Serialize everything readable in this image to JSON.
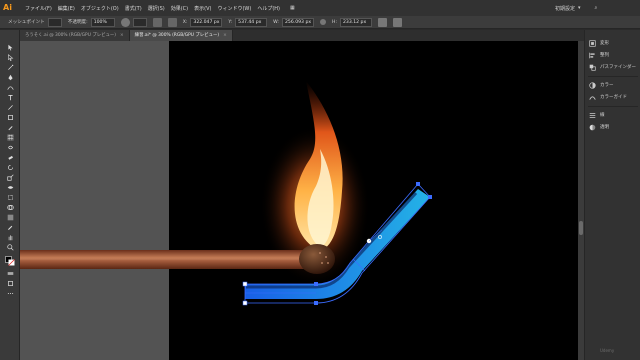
{
  "app": {
    "logo": "Ai"
  },
  "menu": {
    "items": [
      "ファイル(F)",
      "編集(E)",
      "オブジェクト(O)",
      "書式(T)",
      "選択(S)",
      "効果(C)",
      "表示(V)",
      "ウィンドウ(W)",
      "ヘルプ(H)"
    ],
    "layout_icon": "▦",
    "workspace": "初期設定",
    "layout_icon_name": "grid-icon"
  },
  "options": {
    "tool_name": "メッシュポイント",
    "opacity_label": "不透明度:",
    "opacity_value": "100%",
    "x_label": "X:",
    "x_value": "322.047 px",
    "y_label": "Y:",
    "y_value": "537.44 px",
    "w_label": "W:",
    "w_value": "256.093 px",
    "h_label": "H:",
    "h_value": "233.12 px"
  },
  "tabs": [
    {
      "label": "ろうそく.ai @ 300% (RGB/GPU プレビュー)",
      "close": "×",
      "active": false
    },
    {
      "label": "練習.ai* @ 300% (RGB/GPU プレビュー)",
      "close": "×",
      "active": true
    }
  ],
  "panels": [
    {
      "label": "変形",
      "icon": "transform-icon"
    },
    {
      "label": "整列",
      "icon": "align-icon"
    },
    {
      "label": "パスファインダー",
      "icon": "pathfinder-icon"
    },
    {
      "label": "カラー",
      "icon": "color-icon"
    },
    {
      "label": "カラーガイド",
      "icon": "color-guide-icon"
    },
    {
      "label": "線",
      "icon": "stroke-icon"
    },
    {
      "label": "透明",
      "icon": "transparency-icon"
    }
  ],
  "colors": {
    "accent": "#f89a1c",
    "flame_core": "#ffe6a8",
    "flame_outer": "#e0561a",
    "matchstick": "#a0583a",
    "selection": "#3b6cff"
  },
  "watermark": "Udemy"
}
